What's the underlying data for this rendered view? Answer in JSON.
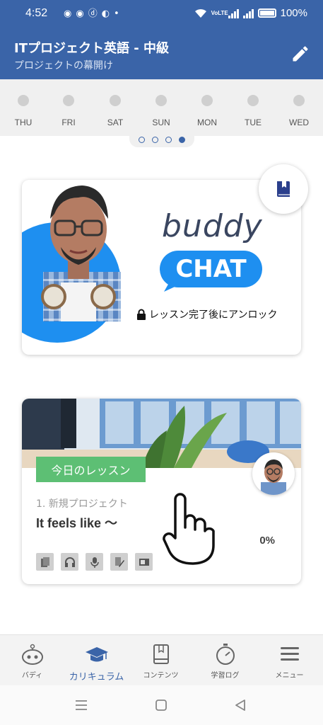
{
  "status_bar": {
    "time": "4:52",
    "network_label": "VoLTE",
    "battery": "100%"
  },
  "header": {
    "title": "ITプロジェクト英語 - 中級",
    "subtitle": "プロジェクトの幕開け"
  },
  "week": {
    "days": [
      "THU",
      "FRI",
      "SAT",
      "SUN",
      "MON",
      "TUE",
      "WED"
    ],
    "active_page": 4,
    "page_count": 4
  },
  "buddy_card": {
    "brand_word": "buddy",
    "chat_word": "CHAT",
    "lock_text": "レッスン完了後にアンロック"
  },
  "lesson_card": {
    "tag": "今日のレッスン",
    "number": "1. 新規プロジェクト",
    "title": "It feels like 〜",
    "progress": "0%"
  },
  "bottom_nav": {
    "items": [
      {
        "label": "バディ",
        "icon": "robot-icon"
      },
      {
        "label": "カリキュラム",
        "icon": "graduation-cap-icon"
      },
      {
        "label": "コンテンツ",
        "icon": "book-icon"
      },
      {
        "label": "学習ログ",
        "icon": "stopwatch-icon"
      },
      {
        "label": "メニュー",
        "icon": "menu-icon"
      }
    ],
    "active_index": 1
  },
  "colors": {
    "primary": "#3a64a8",
    "chat_blue": "#1e8ff0",
    "today_green": "#5dbf74"
  }
}
